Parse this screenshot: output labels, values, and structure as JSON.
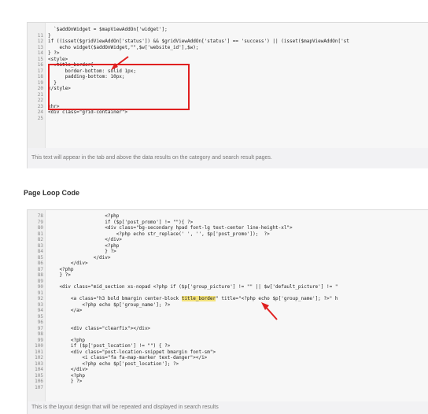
{
  "editor1": {
    "lines": [
      {
        "n": "",
        "t": "  `$addOnWidget = $mapViewAddOn['widget'];"
      },
      {
        "n": "11",
        "t": "}"
      },
      {
        "n": "12",
        "t": "if ((isset($gridViewAddOn['status']) && $gridViewAddOn['status'] == 'success') || (isset($mapViewAddOn['st"
      },
      {
        "n": "13",
        "t": "    echo widget($addOnWidget,\"\",$w['website_id'],$w);"
      },
      {
        "n": "14",
        "t": "} ?>"
      },
      {
        "n": "15",
        "t": "<style>"
      },
      {
        "n": "16",
        "t": "  .title_border{"
      },
      {
        "n": "17",
        "t": "      border-bottom: solid 1px;"
      },
      {
        "n": "18",
        "t": "      padding-bottom: 10px;"
      },
      {
        "n": "19",
        "t": "  }"
      },
      {
        "n": "20",
        "t": "</style>"
      },
      {
        "n": "21",
        "t": ""
      },
      {
        "n": "22",
        "t": ""
      },
      {
        "n": "23",
        "t": "<hr>"
      },
      {
        "n": "24",
        "t": "<div class=\"grid-container\">"
      },
      {
        "n": "25",
        "t": ""
      }
    ],
    "hint": "This text will appear in the tab and above the data results on the category and search result pages."
  },
  "section_title": "Page Loop Code",
  "editor2": {
    "lines": [
      {
        "n": "78",
        "t": "                    <?php"
      },
      {
        "n": "79",
        "t": "                    if ($p['post_promo'] != \"\"){ ?>"
      },
      {
        "n": "80",
        "t": "                    <div class=\"bg-secondary hpad font-lg text-center line-height-xl\">"
      },
      {
        "n": "81",
        "t": "                        <?php echo str_replace(' ', '', $p['post_promo']);  ?>"
      },
      {
        "n": "82",
        "t": "                    </div>"
      },
      {
        "n": "83",
        "t": "                    <?php"
      },
      {
        "n": "84",
        "t": "                    } ?>"
      },
      {
        "n": "85",
        "t": "                </div>"
      },
      {
        "n": "86",
        "t": "        </div>"
      },
      {
        "n": "87",
        "t": "    <?php"
      },
      {
        "n": "88",
        "t": "    } ?>"
      },
      {
        "n": "89",
        "t": ""
      },
      {
        "n": "90",
        "t": "    <div class=\"mid_section xs-nopad <?php if ($p['group_picture'] != \"\" || $w['default_picture'] != \""
      },
      {
        "n": "91",
        "t": ""
      },
      {
        "n": "92",
        "t": "        <a class=\"h3 bold bmargin center-block title_border\" title=\"<?php echo $p['group_name']; ?>\" h"
      },
      {
        "n": "93",
        "t": "            <?php echo $p['group_name']; ?>"
      },
      {
        "n": "94",
        "t": "        </a>"
      },
      {
        "n": "95",
        "t": ""
      },
      {
        "n": "96",
        "t": ""
      },
      {
        "n": "97",
        "t": "        <div class=\"clearfix\"></div>"
      },
      {
        "n": "98",
        "t": ""
      },
      {
        "n": "99",
        "t": "        <?php"
      },
      {
        "n": "100",
        "t": "        if ($p['post_location'] != \"\") { ?>"
      },
      {
        "n": "101",
        "t": "        <div class=\"post-location-snippet bmargin font-sm\">"
      },
      {
        "n": "102",
        "t": "            <i class=\"fa fa-map-marker text-danger\"></i>"
      },
      {
        "n": "103",
        "t": "            <?php echo $p['post_location']; ?>"
      },
      {
        "n": "104",
        "t": "        </div>"
      },
      {
        "n": "105",
        "t": "        <?php"
      },
      {
        "n": "106",
        "t": "        } ?>"
      },
      {
        "n": "107",
        "t": ""
      }
    ],
    "hint": "This is the layout design that will be repeated and displayed in search results"
  },
  "annotation_color": "#e02020",
  "highlight_color": "#f3e27a"
}
